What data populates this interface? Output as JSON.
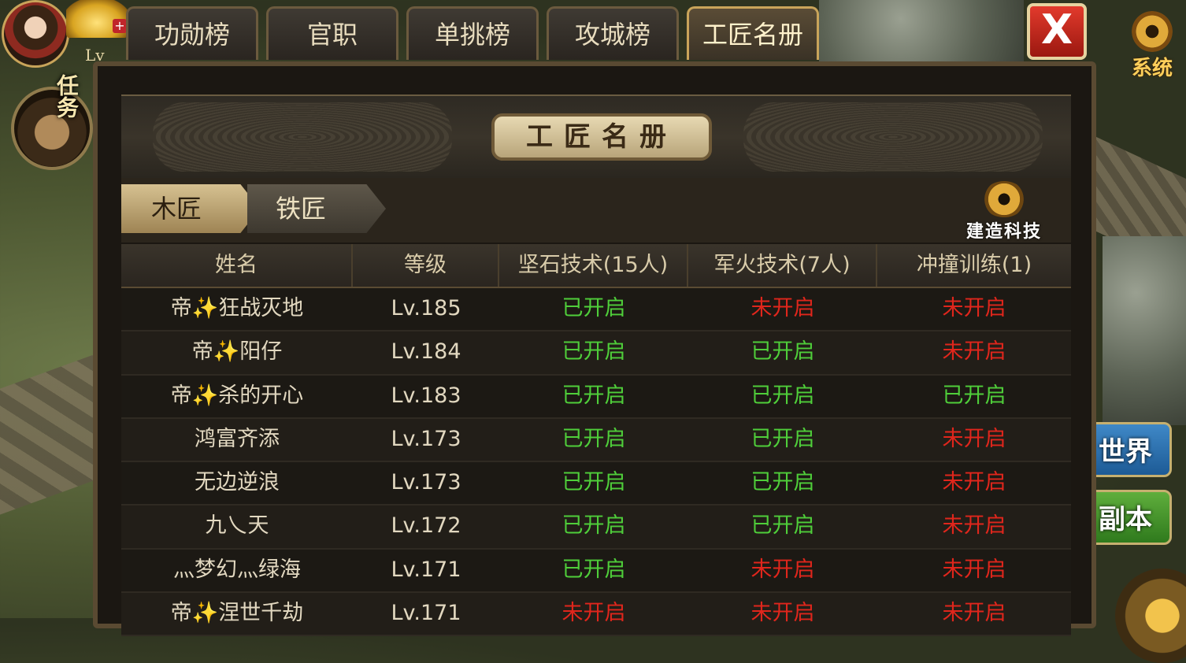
{
  "hud": {
    "level_label": "Lv",
    "quest_label": "任务",
    "system_label": "系统",
    "world_button": "世界",
    "dungeon_button": "副本"
  },
  "tabs": [
    {
      "label": "功勋榜"
    },
    {
      "label": "官职"
    },
    {
      "label": "单挑榜"
    },
    {
      "label": "攻城榜"
    },
    {
      "label": "工匠名册"
    }
  ],
  "close_label": "X",
  "panel": {
    "title": "工匠名册",
    "sub_tabs": [
      "木匠",
      "铁匠"
    ],
    "build_tech_label": "建造科技"
  },
  "table": {
    "headers": [
      "姓名",
      "等级",
      "坚石技术(15人)",
      "军火技术(7人)",
      "冲撞训练(1)"
    ],
    "rows": [
      {
        "name": "帝✨狂战灭地",
        "level": "Lv.185",
        "stone": "已开启",
        "arms": "未开启",
        "ram": "未开启"
      },
      {
        "name": "帝✨阳仔",
        "level": "Lv.184",
        "stone": "已开启",
        "arms": "已开启",
        "ram": "未开启"
      },
      {
        "name": "帝✨杀的开心",
        "level": "Lv.183",
        "stone": "已开启",
        "arms": "已开启",
        "ram": "已开启"
      },
      {
        "name": "鸿富齐添",
        "level": "Lv.173",
        "stone": "已开启",
        "arms": "已开启",
        "ram": "未开启"
      },
      {
        "name": "无边逆浪",
        "level": "Lv.173",
        "stone": "已开启",
        "arms": "已开启",
        "ram": "未开启"
      },
      {
        "name": "九乀天",
        "level": "Lv.172",
        "stone": "已开启",
        "arms": "已开启",
        "ram": "未开启"
      },
      {
        "name": "灬梦幻灬绿海",
        "level": "Lv.171",
        "stone": "已开启",
        "arms": "未开启",
        "ram": "未开启"
      },
      {
        "name": "帝✨涅世千劫",
        "level": "Lv.171",
        "stone": "未开启",
        "arms": "未开启",
        "ram": "未开启"
      }
    ]
  },
  "colors": {
    "enabled": "#4fce3a",
    "disabled": "#e0261c",
    "accent_gold": "#c9a45a"
  }
}
